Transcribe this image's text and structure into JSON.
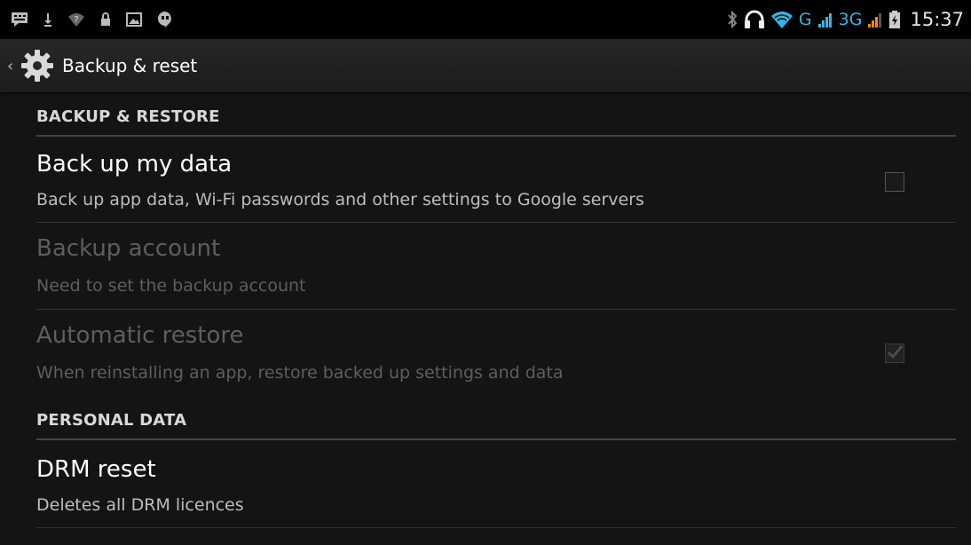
{
  "status_bar": {
    "left_icons": [
      "message-icon",
      "download-icon",
      "wifi-question-icon",
      "lock-icon",
      "image-icon",
      "talk-icon"
    ],
    "right": {
      "icons": [
        "bluetooth-icon",
        "headset-icon",
        "wifi-icon"
      ],
      "network_1": "G",
      "network_2": "3G",
      "time": "15:37"
    }
  },
  "action_bar": {
    "title": "Backup & reset",
    "icon": "settings-gear-icon"
  },
  "sections": [
    {
      "header": "BACKUP & RESTORE",
      "items": [
        {
          "title": "Back up my data",
          "summary": "Back up app data, Wi-Fi passwords and other settings to Google servers",
          "enabled": true,
          "checked": false
        },
        {
          "title": "Backup account",
          "summary": "Need to set the backup account",
          "enabled": false
        },
        {
          "title": "Automatic restore",
          "summary": "When reinstalling an app, restore backed up settings and data",
          "enabled": false,
          "checked": true
        }
      ]
    },
    {
      "header": "PERSONAL DATA",
      "items": [
        {
          "title": "DRM reset",
          "summary": "Deletes all DRM licences",
          "enabled": true
        }
      ]
    }
  ],
  "colors": {
    "accent": "#33b5e5",
    "background": "#141414",
    "disabled_text": "#5e5e5e"
  }
}
